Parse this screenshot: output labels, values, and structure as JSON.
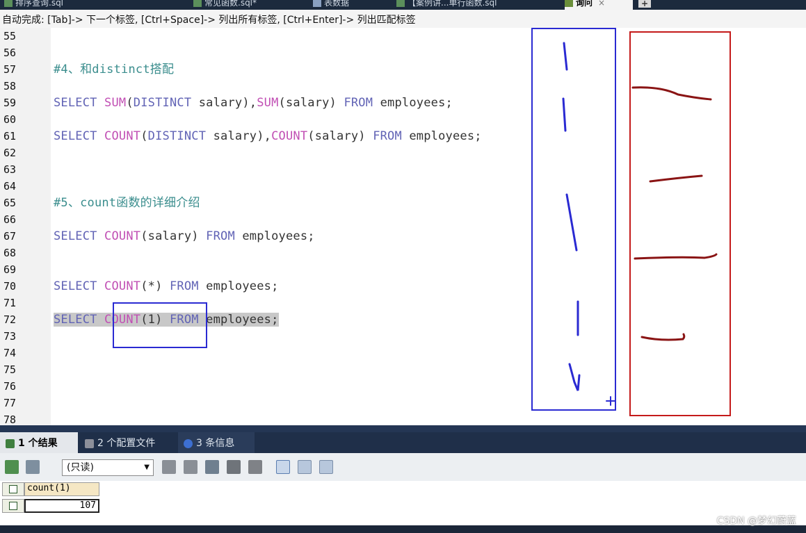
{
  "tabs": [
    {
      "label": "排序查询.sql",
      "active": false
    },
    {
      "label": "常见函数.sql*",
      "active": false
    },
    {
      "label": "表数据",
      "active": false
    },
    {
      "label": "【案例讲...单行函数.sql",
      "active": false
    },
    {
      "label": "询问",
      "active": true
    }
  ],
  "tab_close": "×",
  "tab_add": "+",
  "autocomplete_hint": "自动完成: [Tab]-> 下一个标签, [Ctrl+Space]-> 列出所有标签, [Ctrl+Enter]-> 列出匹配标签",
  "line_numbers": [
    "55",
    "56",
    "57",
    "58",
    "59",
    "60",
    "61",
    "62",
    "63",
    "64",
    "65",
    "66",
    "67",
    "68",
    "69",
    "70",
    "71",
    "72",
    "73",
    "74",
    "75",
    "76",
    "77",
    "78"
  ],
  "code": {
    "comment4": "#4、和distinct搭配",
    "line59": {
      "kw1": "SELECT",
      "fn1": "SUM",
      "p1": "(",
      "kw2": "DISTINCT",
      "t1": " salary),",
      "fn2": "SUM",
      "t2": "(salary) ",
      "kw3": "FROM",
      "t3": " employees;"
    },
    "line61": {
      "kw1": "SELECT",
      "fn1": "COUNT",
      "p1": "(",
      "kw2": "DISTINCT",
      "t1": " salary),",
      "fn2": "COUNT",
      "t2": "(salary) ",
      "kw3": "FROM",
      "t3": " employees;"
    },
    "comment5": "#5、count函数的详细介绍",
    "line67": {
      "kw1": "SELECT",
      "fn1": "COUNT",
      "t1": "(salary) ",
      "kw2": "FROM",
      "t2": " employees;"
    },
    "line70": {
      "kw1": "SELECT",
      "fn1": "COUNT",
      "t1": "(*) ",
      "kw2": "FROM",
      "t2": " employees;"
    },
    "line72": {
      "kw1": "SELECT",
      "fn1": "COUNT",
      "t1": "(1) ",
      "kw2": "FROM",
      "t2": " employees;"
    }
  },
  "result_tabs": [
    {
      "label": "1 个结果",
      "active": true
    },
    {
      "label": "2 个配置文件",
      "active": false
    },
    {
      "label": "3 条信息",
      "active": false
    }
  ],
  "toolbar": {
    "mode_select": "(只读)"
  },
  "result_grid": {
    "columns": [
      "count(1)"
    ],
    "rows": [
      [
        "107"
      ]
    ]
  },
  "watermark": "CSDN @梦幻蔚蓝",
  "colors": {
    "keyword": "#6163b5",
    "function": "#c14fb4",
    "comment": "#3a8d8d",
    "annotation_blue": "#2a2ad2",
    "annotation_red": "#c41a1a"
  }
}
